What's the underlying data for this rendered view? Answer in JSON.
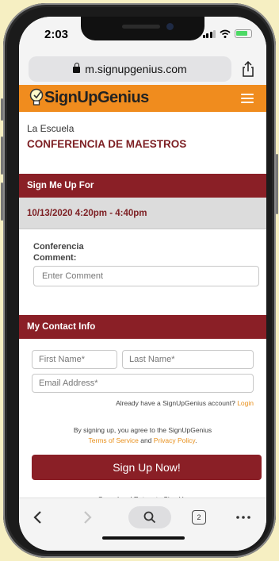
{
  "status": {
    "time": "2:03"
  },
  "browser": {
    "url": "m.signupgenius.com",
    "tab_count": "2"
  },
  "site": {
    "brand": "SignUpGenius"
  },
  "signup": {
    "organization": "La Escuela",
    "title": "CONFERENCIA DE MAESTROS",
    "sign_me_up_header": "Sign Me Up For",
    "slot": "10/13/2020 4:20pm - 4:40pm",
    "item_name": "Conferencia",
    "comment_label": "Comment:",
    "comment_placeholder": "Enter Comment"
  },
  "contact": {
    "header": "My Contact Info",
    "first_name_placeholder": "First Name*",
    "last_name_placeholder": "Last Name*",
    "email_placeholder": "Email Address*",
    "account_prompt": "Already have a SignUpGenius account?",
    "login_link": "Login",
    "agree_text": "By signing up, you agree to the SignUpGenius",
    "terms_link": "Terms of Service",
    "and_text": "and",
    "privacy_link": "Privacy Policy",
    "period": ".",
    "signup_button": "Sign Up Now!",
    "cancel_link": "Cancel and Return to Sign Up"
  },
  "colors": {
    "brand_orange": "#f08c1e",
    "accent_maroon": "#8a1f26",
    "link_orange": "#e8901c"
  },
  "icons": [
    "lock-icon",
    "share-icon",
    "lightbulb-logo-icon",
    "hamburger-menu-icon",
    "back-icon",
    "forward-icon",
    "search-icon",
    "tabs-icon",
    "more-icon"
  ]
}
